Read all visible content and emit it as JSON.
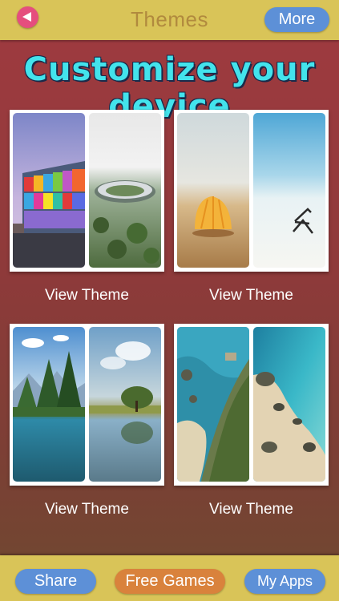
{
  "header": {
    "title": "Themes",
    "more_label": "More",
    "back_icon": "back-arrow-icon"
  },
  "banner": {
    "text": "Customize your device",
    "color": "#43e3ec"
  },
  "themes": [
    {
      "label": "View Theme"
    },
    {
      "label": "View Theme"
    },
    {
      "label": "View Theme"
    },
    {
      "label": "View Theme"
    }
  ],
  "footer": {
    "share_label": "Share",
    "games_label": "Free Games",
    "apps_label": "My Apps"
  },
  "colors": {
    "bar": "#d9c458",
    "button_blue": "#5d90d7",
    "button_orange": "#d9823c",
    "back_pink": "#e54e7e",
    "background": "#8e3a3a"
  }
}
